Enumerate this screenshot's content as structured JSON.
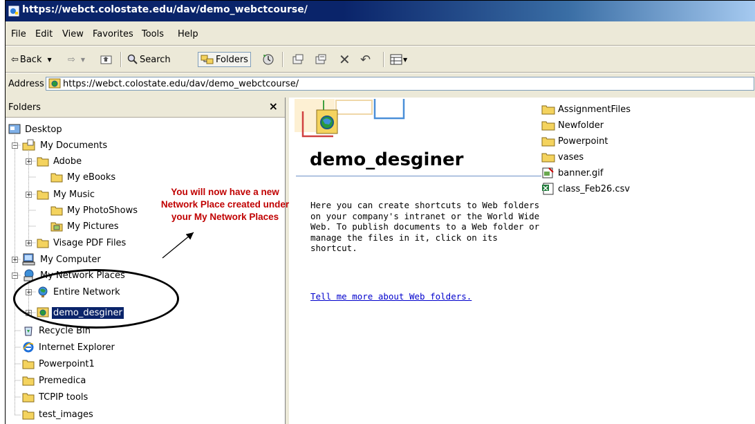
{
  "window": {
    "title": "https://webct.colostate.edu/dav/demo_webctcourse/"
  },
  "menu": [
    "File",
    "Edit",
    "View",
    "Favorites",
    "Tools",
    "Help"
  ],
  "toolbar": {
    "back": "Back",
    "search": "Search",
    "folders": "Folders"
  },
  "address": {
    "label": "Address",
    "value": "https://webct.colostate.edu/dav/demo_webctcourse/"
  },
  "folders_pane": {
    "title": "Folders",
    "close": "×",
    "items": {
      "desktop": "Desktop",
      "my_documents": "My Documents",
      "adobe": "Adobe",
      "my_ebooks": "My eBooks",
      "my_music": "My Music",
      "my_photoshows": "My PhotoShows",
      "my_pictures": "My Pictures",
      "visage": "Visage PDF Files",
      "my_computer": "My Computer",
      "my_network_places": "My Network Places",
      "entire_network": "Entire Network",
      "demo_desginer": "demo_desginer",
      "recycle_bin": "Recycle Bin",
      "internet_explorer": "Internet Explorer",
      "powerpoint1": "Powerpoint1",
      "premedica": "Premedica",
      "tcpip": "TCPIP tools",
      "test_images": "test_images"
    }
  },
  "content": {
    "title": "demo_desginer",
    "description": "Here you can create shortcuts to Web folders on your company's intranet or the World Wide Web. To publish documents to a Web folder or manage the files in it, click on its shortcut.",
    "link": "Tell me more about Web folders.",
    "files": [
      "AssignmentFiles",
      "Newfolder",
      "Powerpoint",
      "vases",
      "banner.gif",
      "class_Feb26.csv"
    ]
  },
  "annotation": {
    "line1": "You will now have a new",
    "line2": "Network Place created under",
    "line3": "your My Network Places",
    "color": "#c00000"
  }
}
